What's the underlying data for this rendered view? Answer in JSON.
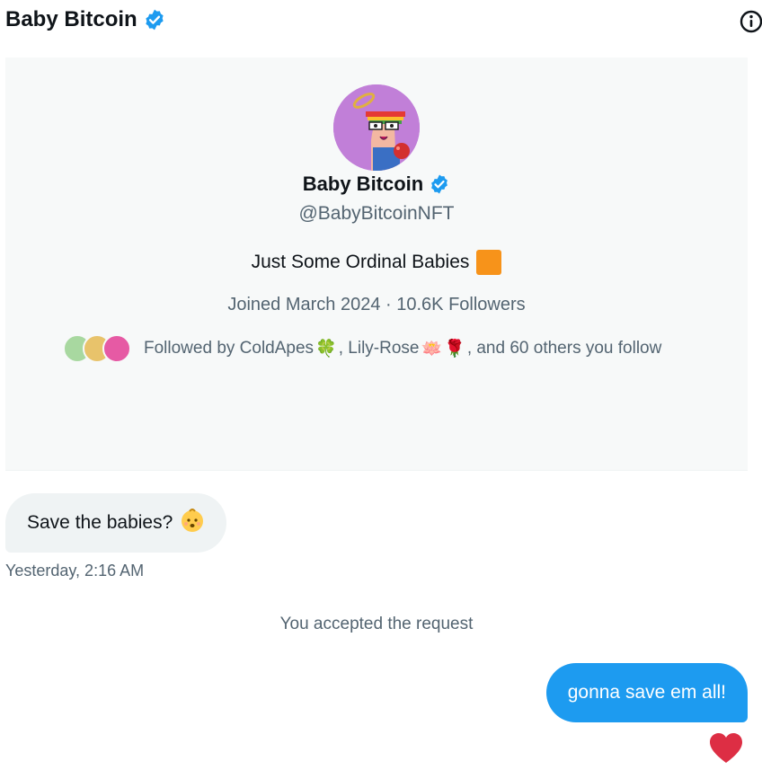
{
  "header": {
    "title": "Baby Bitcoin",
    "verified_icon": "verified-badge-icon",
    "info_icon": "info-icon"
  },
  "profile": {
    "name": "Baby Bitcoin",
    "handle": "@BabyBitcoinNFT",
    "bio": "Just Some Ordinal Babies",
    "bio_icon": "orange-square-emoji",
    "meta": "Joined March 2024 · 10.6K Followers",
    "followed_by": {
      "prefix": "Followed by ColdApes",
      "clover": "🍀",
      "middle": ", Lily-Rose",
      "lotus": "🪷",
      "rose": "🌹",
      "suffix": ", and 60 others you follow"
    }
  },
  "messages": {
    "incoming": {
      "text": "Save the babies?",
      "emoji_icon": "baby-emoji",
      "time": "Yesterday, 2:16 AM"
    },
    "system": "You accepted the request",
    "outgoing": {
      "text": "gonna save em all!",
      "reaction_icon": "heart-icon"
    }
  },
  "colors": {
    "accent": "#1d9bf0",
    "verified": "#1d9bf0",
    "card_bg": "#f7f9f9",
    "incoming_bg": "#eff3f4",
    "heart": "#f91880",
    "bitcoin_orange": "#f7931a",
    "muted_text": "#536471"
  }
}
